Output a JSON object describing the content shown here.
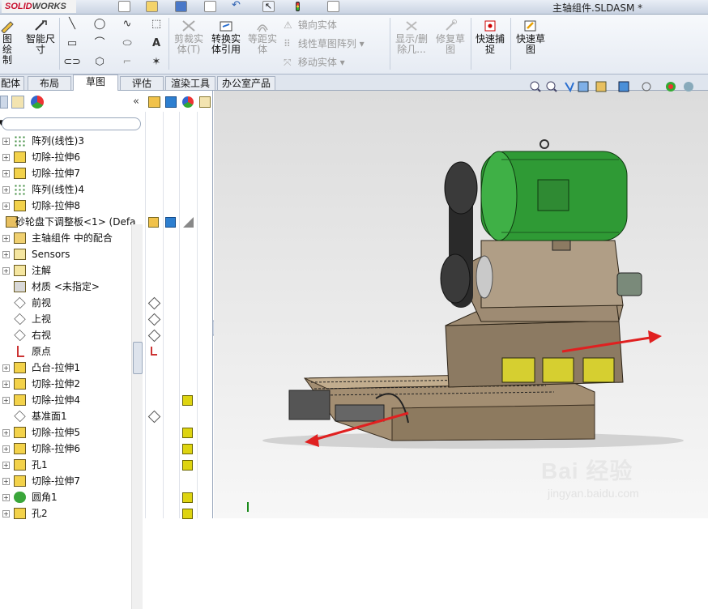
{
  "app": {
    "brand_left": "SOLID",
    "brand_right": "WORKS",
    "document_title": "主轴组件.SLDASM *"
  },
  "ribbon": {
    "sketch_label": "图绘\n制",
    "smart_dim_label": "智能尺\n寸",
    "trim_label": "剪裁实\n体(T)",
    "convert_label": "转换实\n体引用",
    "offset_label": "等距实\n体",
    "mirror_label": "镜向实体",
    "linear_pattern_label": "线性草图阵列",
    "move_label": "移动实体",
    "show_hide_label": "显示/删\n除几...",
    "repair_label": "修复草\n图",
    "quick_snap_label": "快速捕\n捉",
    "rapid_sketch_label": "快速草\n图"
  },
  "tabs": [
    {
      "label": "配体"
    },
    {
      "label": "布局"
    },
    {
      "label": "草图"
    },
    {
      "label": "评估"
    },
    {
      "label": "渲染工具"
    },
    {
      "label": "办公室产品"
    }
  ],
  "tree": {
    "items": [
      {
        "label": "阵列(线性)3",
        "icon": "linear-pattern-icon"
      },
      {
        "label": "切除-拉伸6",
        "icon": "cut-extrude-icon"
      },
      {
        "label": "切除-拉伸7",
        "icon": "cut-extrude-icon"
      },
      {
        "label": "阵列(线性)4",
        "icon": "linear-pattern-icon"
      },
      {
        "label": "切除-拉伸8",
        "icon": "cut-extrude-icon"
      },
      {
        "label": "砂轮盘下调整板<1> (Defa",
        "icon": "part-icon"
      },
      {
        "label": "主轴组件 中的配合",
        "icon": "mates-icon"
      },
      {
        "label": "Sensors",
        "icon": "sensors-icon"
      },
      {
        "label": "注解",
        "icon": "annotations-icon"
      },
      {
        "label": "材质 <未指定>",
        "icon": "material-icon"
      },
      {
        "label": "前视",
        "icon": "plane-icon"
      },
      {
        "label": "上视",
        "icon": "plane-icon"
      },
      {
        "label": "右视",
        "icon": "plane-icon"
      },
      {
        "label": "原点",
        "icon": "origin-icon"
      },
      {
        "label": "凸台-拉伸1",
        "icon": "boss-extrude-icon"
      },
      {
        "label": "切除-拉伸2",
        "icon": "cut-extrude-icon"
      },
      {
        "label": "切除-拉伸4",
        "icon": "cut-extrude-icon"
      },
      {
        "label": "基准面1",
        "icon": "plane-icon"
      },
      {
        "label": "切除-拉伸5",
        "icon": "cut-extrude-icon"
      },
      {
        "label": "切除-拉伸6",
        "icon": "cut-extrude-icon"
      },
      {
        "label": "孔1",
        "icon": "hole-icon"
      },
      {
        "label": "切除-拉伸7",
        "icon": "cut-extrude-icon"
      },
      {
        "label": "圆角1",
        "icon": "fillet-icon"
      },
      {
        "label": "孔2",
        "icon": "hole-icon"
      }
    ]
  },
  "watermark": {
    "logo": "Bai 经验",
    "url": "jingyan.baidu.com"
  },
  "colors": {
    "accent": "#2f6fcf",
    "motor_green": "#2f9a35",
    "machine_tan": "#8c7a62",
    "arrow_red": "#e02020"
  }
}
